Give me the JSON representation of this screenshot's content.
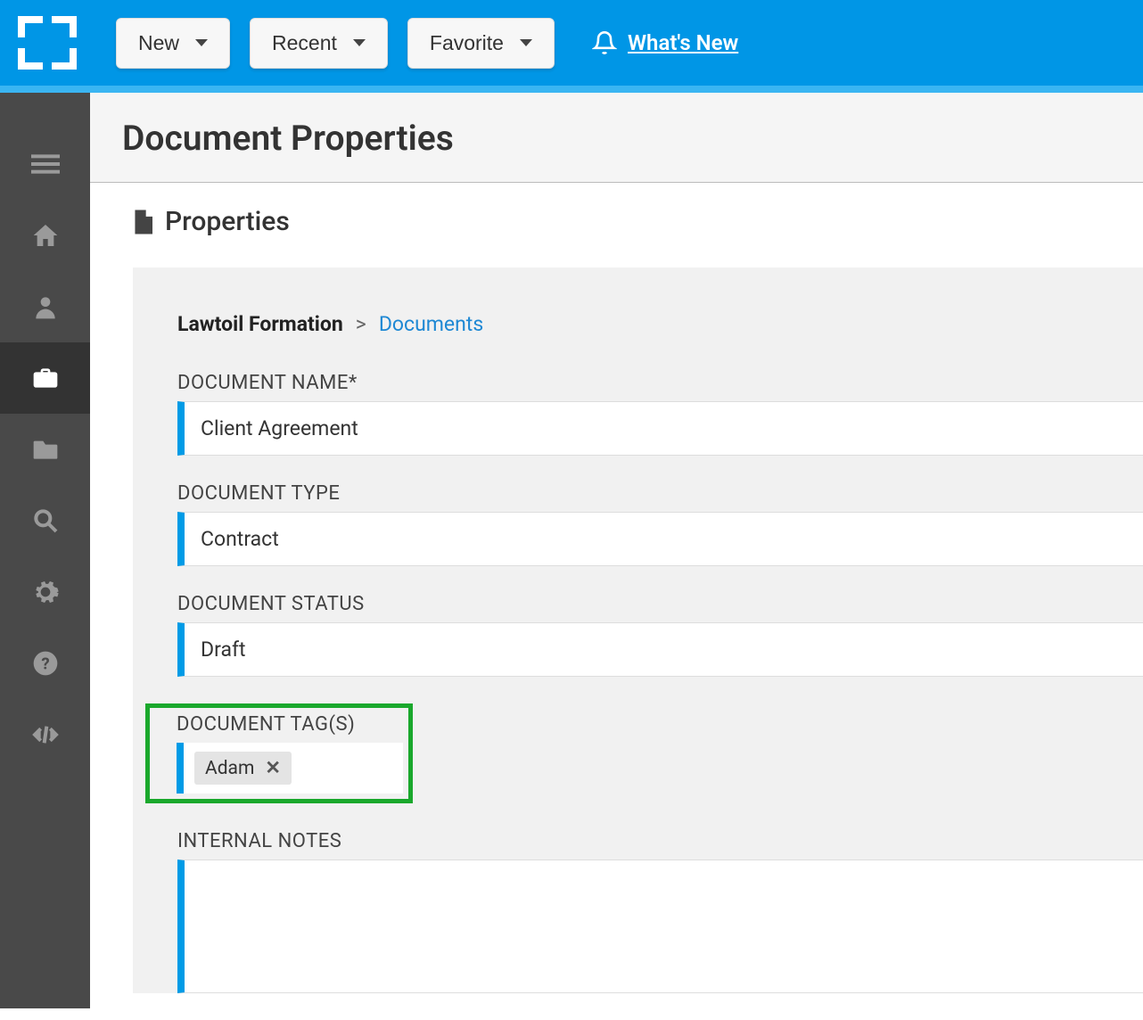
{
  "topbar": {
    "buttons": {
      "new": "New",
      "recent": "Recent",
      "favorite": "Favorite"
    },
    "whats_new": "What's New"
  },
  "page": {
    "title": "Document Properties",
    "section": "Properties"
  },
  "breadcrumb": {
    "root": "Lawtoil Formation",
    "link": "Documents"
  },
  "fields": {
    "document_name_label": "DOCUMENT NAME*",
    "document_name_value": "Client Agreement",
    "document_type_label": "DOCUMENT TYPE",
    "document_type_value": "Contract",
    "document_status_label": "DOCUMENT STATUS",
    "document_status_value": "Draft",
    "document_tags_label": "DOCUMENT TAG(S)",
    "tags": [
      "Adam"
    ],
    "internal_notes_label": "INTERNAL NOTES",
    "internal_notes_value": ""
  }
}
